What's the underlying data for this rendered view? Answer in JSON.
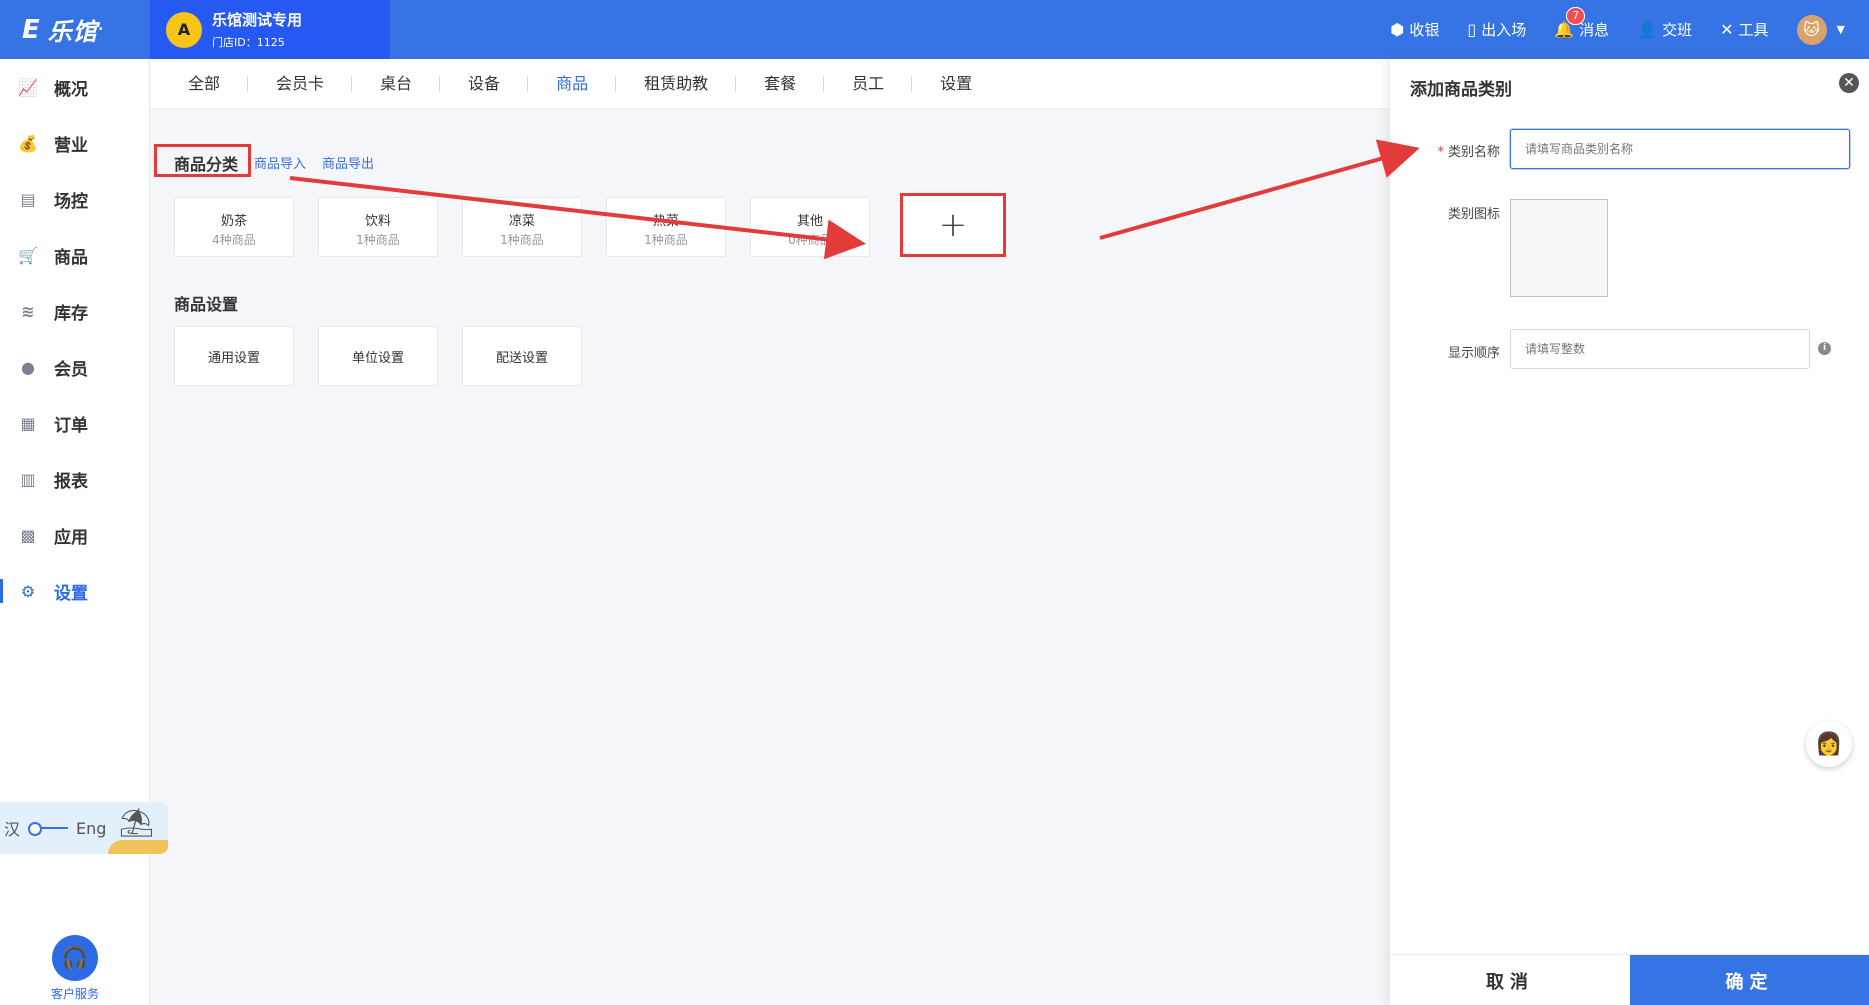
{
  "app": {
    "logo_mark": "E",
    "logo_text": "乐馆",
    "logo_dot": "•",
    "store_name": "乐馆测试专用",
    "store_id": "门店ID：1125",
    "store_avatar_letter": "A"
  },
  "top_actions": {
    "cashier": "收银",
    "entry": "出入场",
    "messages": "消息",
    "messages_badge": "7",
    "shift": "交班",
    "tools": "工具"
  },
  "sidebar": {
    "items": [
      {
        "label": "概况",
        "icon": "chart-icon"
      },
      {
        "label": "营业",
        "icon": "money-bag-icon"
      },
      {
        "label": "场控",
        "icon": "venue-control-icon"
      },
      {
        "label": "商品",
        "icon": "cart-icon"
      },
      {
        "label": "库存",
        "icon": "layers-icon"
      },
      {
        "label": "会员",
        "icon": "member-icon"
      },
      {
        "label": "订单",
        "icon": "order-icon"
      },
      {
        "label": "报表",
        "icon": "bar-chart-icon"
      },
      {
        "label": "应用",
        "icon": "apps-icon"
      },
      {
        "label": "设置",
        "icon": "gear-icon"
      }
    ],
    "active_index": 9,
    "lang_left": "汉",
    "lang_right": "Eng",
    "service": "客户服务"
  },
  "tabs": [
    "全部",
    "会员卡",
    "桌台",
    "设备",
    "商品",
    "租赁助教",
    "套餐",
    "员工",
    "设置"
  ],
  "active_tab": 4,
  "main": {
    "category_title": "商品分类",
    "import_link": "商品导入",
    "export_link": "商品导出",
    "categories": [
      {
        "name": "奶茶",
        "count": "4种商品"
      },
      {
        "name": "饮料",
        "count": "1种商品"
      },
      {
        "name": "凉菜",
        "count": "1种商品"
      },
      {
        "name": "热菜",
        "count": "1种商品"
      },
      {
        "name": "其他",
        "count": "0种商品"
      }
    ],
    "add_symbol": "+",
    "settings_title": "商品设置",
    "settings": [
      "通用设置",
      "单位设置",
      "配送设置"
    ]
  },
  "panel": {
    "title": "添加商品类别",
    "close": "✕",
    "name_label": "类别名称",
    "required_mark": "*",
    "name_placeholder": "请填写商品类别名称",
    "icon_label": "类别图标",
    "order_label": "显示顺序",
    "order_placeholder": "请填写整数",
    "info": "i",
    "cancel": "取消",
    "confirm": "确定"
  },
  "colors": {
    "brand": "#3674e6",
    "highlight_red": "#e33a3a"
  }
}
